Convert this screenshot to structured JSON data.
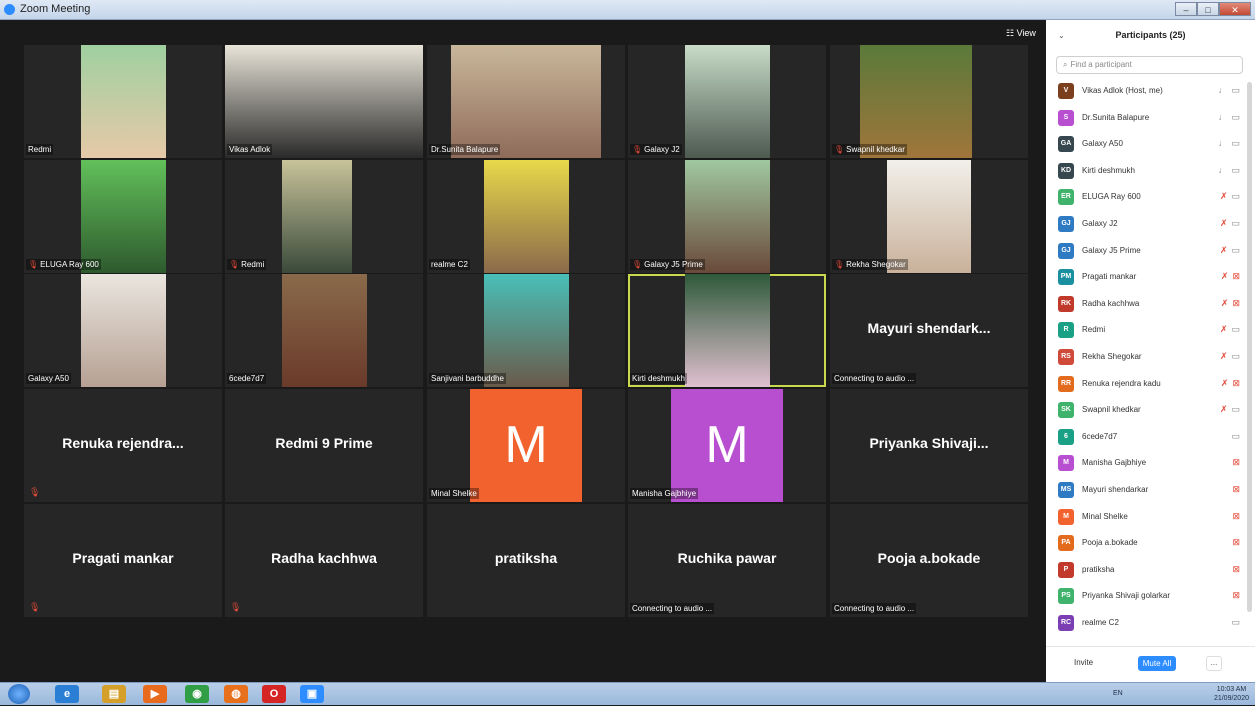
{
  "window": {
    "title": "Zoom Meeting",
    "min": "–",
    "max": "□",
    "close": "✕"
  },
  "view_label": "☷ View",
  "tiles": [
    {
      "name": "Redmi",
      "muted": false
    },
    {
      "name": "Vikas Adlok",
      "muted": false
    },
    {
      "name": "Dr.Sunita Balapure",
      "muted": false
    },
    {
      "name": "Galaxy J2",
      "muted": true
    },
    {
      "name": "Swapnil khedkar",
      "muted": true
    },
    {
      "name": "ELUGA Ray 600",
      "muted": true
    },
    {
      "name": "Redmi",
      "muted": true
    },
    {
      "name": "realme C2",
      "muted": false
    },
    {
      "name": "Galaxy J5 Prime",
      "muted": true
    },
    {
      "name": "Rekha Shegokar",
      "muted": true
    },
    {
      "name": "Galaxy A50",
      "muted": false
    },
    {
      "name": "6cede7d7",
      "muted": false
    },
    {
      "name": "Sanjivani barbuddhe",
      "muted": false
    },
    {
      "name": "Kirti deshmukh",
      "muted": false
    },
    {
      "name": "Connecting to audio ...",
      "big": "Mayuri shendark..."
    },
    {
      "big": "Renuka rejendra..."
    },
    {
      "big": "Redmi 9 Prime"
    },
    {
      "name": "Minal Shelke",
      "avatar": "M"
    },
    {
      "name": "Manisha Gajbhiye",
      "avatar": "M"
    },
    {
      "big": "Priyanka Shivaji..."
    },
    {
      "big": "Pragati mankar"
    },
    {
      "big": "Radha kachhwa"
    },
    {
      "big": "pratiksha"
    },
    {
      "name": "Connecting to audio ...",
      "big": "Ruchika pawar"
    },
    {
      "name": "Connecting to audio ...",
      "big": "Pooja a.bokade"
    }
  ],
  "panel": {
    "title": "Participants (25)",
    "chevron": "⌄",
    "search_placeholder": "Find a participant",
    "participants": [
      {
        "initials": "V",
        "name": "Vikas Adlok (Host, me)",
        "color": "#7b3f1d",
        "mic": "on",
        "cam": "on"
      },
      {
        "initials": "S",
        "name": "Dr.Sunita Balapure",
        "color": "#b84fd0",
        "mic": "on",
        "cam": "on"
      },
      {
        "initials": "GA",
        "name": "Galaxy A50",
        "color": "#37474f",
        "mic": "on",
        "cam": "on"
      },
      {
        "initials": "KD",
        "name": "Kirti deshmukh",
        "color": "#37474f",
        "mic": "on",
        "cam": "on"
      },
      {
        "initials": "ER",
        "name": "ELUGA Ray 600",
        "color": "#3fb36b",
        "mic": "muted",
        "cam": "on"
      },
      {
        "initials": "GJ",
        "name": "Galaxy J2",
        "color": "#2e7bc4",
        "mic": "muted",
        "cam": "on"
      },
      {
        "initials": "GJ",
        "name": "Galaxy J5 Prime",
        "color": "#2e7bc4",
        "mic": "muted",
        "cam": "on"
      },
      {
        "initials": "PM",
        "name": "Pragati mankar",
        "color": "#1a8fa0",
        "mic": "muted",
        "cam": "off"
      },
      {
        "initials": "RK",
        "name": "Radha kachhwa",
        "color": "#c0392b",
        "mic": "muted",
        "cam": "off"
      },
      {
        "initials": "R",
        "name": "Redmi",
        "color": "#1aa085",
        "mic": "muted",
        "cam": "on"
      },
      {
        "initials": "RS",
        "name": "Rekha Shegokar",
        "color": "#d04a3a",
        "mic": "muted",
        "cam": "on"
      },
      {
        "initials": "RR",
        "name": "Renuka rejendra kadu",
        "color": "#e36b1e",
        "mic": "muted",
        "cam": "off"
      },
      {
        "initials": "SK",
        "name": "Swapnil khedkar",
        "color": "#3fb36b",
        "mic": "muted",
        "cam": "on"
      },
      {
        "initials": "6",
        "name": "6cede7d7",
        "color": "#1aa085",
        "mic": "none",
        "cam": "on"
      },
      {
        "initials": "M",
        "name": "Manisha Gajbhiye",
        "color": "#b84fd0",
        "mic": "none",
        "cam": "off"
      },
      {
        "initials": "MS",
        "name": "Mayuri shendarkar",
        "color": "#2e7bc4",
        "mic": "none",
        "cam": "off"
      },
      {
        "initials": "M",
        "name": "Minal Shelke",
        "color": "#f2622e",
        "mic": "none",
        "cam": "off"
      },
      {
        "initials": "PA",
        "name": "Pooja a.bokade",
        "color": "#e36b1e",
        "mic": "none",
        "cam": "off"
      },
      {
        "initials": "P",
        "name": "pratiksha",
        "color": "#c0392b",
        "mic": "none",
        "cam": "off"
      },
      {
        "initials": "PS",
        "name": "Priyanka Shivaji golarkar",
        "color": "#3fb36b",
        "mic": "none",
        "cam": "off"
      },
      {
        "initials": "RC",
        "name": "realme C2",
        "color": "#7b3fb3",
        "mic": "none",
        "cam": "on"
      }
    ],
    "invite": "Invite",
    "mute_all": "Mute All",
    "more": "..."
  },
  "taskbar": {
    "apps": [
      {
        "glyph": "e",
        "color": "#2a7fd4"
      },
      {
        "glyph": "▤",
        "color": "#d4a02a"
      },
      {
        "glyph": "▶",
        "color": "#e86a1c"
      },
      {
        "glyph": "◉",
        "color": "#2f9e44"
      },
      {
        "glyph": "◍",
        "color": "#e8701c"
      },
      {
        "glyph": "O",
        "color": "#d42424"
      },
      {
        "glyph": "▣",
        "color": "#2d8cff"
      }
    ],
    "lang": "EN",
    "time": "10:03 AM",
    "date": "21/09/2020"
  },
  "colors": {
    "accent": "#2d8cff",
    "active_speaker": "#c9d84c",
    "muted": "#e34b3a"
  }
}
